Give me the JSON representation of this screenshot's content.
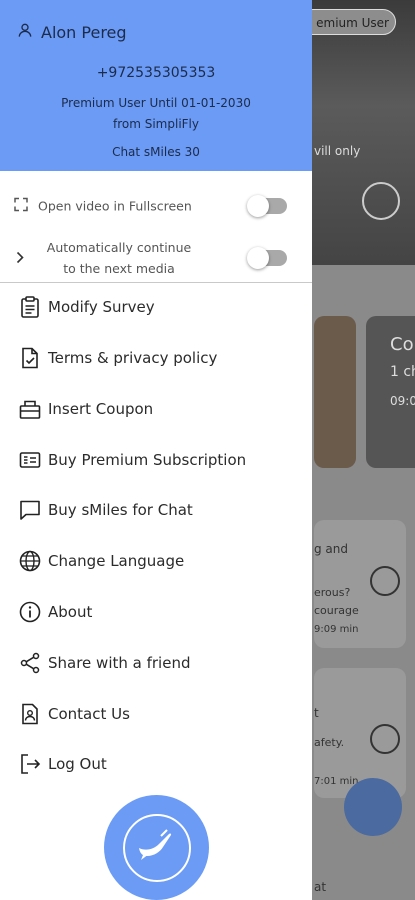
{
  "background": {
    "badge_text": "emium User",
    "overlay_text": "vill only",
    "card_title": "Co",
    "card_sub": "1 ch",
    "card_time": "09:0",
    "list1_line1": "g and",
    "list1_line2": "erous?",
    "list1_line3": "courage",
    "list1_time": "9:09 min",
    "list2_line1": "t",
    "list2_line2": "afety.",
    "list2_time": "7:01 min",
    "bottom_text": "at"
  },
  "header": {
    "user_name": "Alon Pereg",
    "phone": "+972535305353",
    "premium_line1": "Premium User Until 01-01-2030",
    "premium_line2": "from SimpliFly",
    "chat_smiles": "Chat sMiles 30",
    "color": "#6b9bf5"
  },
  "settings": [
    {
      "label": "Open video in Fullscreen",
      "icon": "fullscreen-icon",
      "enabled": false
    },
    {
      "label_line1": "Automatically continue",
      "label_line2": "to the next media",
      "icon": "chevron-right-icon",
      "enabled": false
    }
  ],
  "menu": [
    {
      "label": "Modify Survey",
      "icon": "clipboard-icon"
    },
    {
      "label": "Terms & privacy policy",
      "icon": "document-check-icon"
    },
    {
      "label": "Insert Coupon",
      "icon": "ticket-icon"
    },
    {
      "label": "Buy Premium Subscription",
      "icon": "card-icon"
    },
    {
      "label": "Buy sMiles for Chat",
      "icon": "chat-icon"
    },
    {
      "label": "Change Language",
      "icon": "globe-icon"
    },
    {
      "label": "About",
      "icon": "info-icon"
    },
    {
      "label": "Share with a friend",
      "icon": "share-icon"
    },
    {
      "label": "Contact Us",
      "icon": "contact-icon"
    },
    {
      "label": "Log Out",
      "icon": "logout-icon"
    }
  ]
}
